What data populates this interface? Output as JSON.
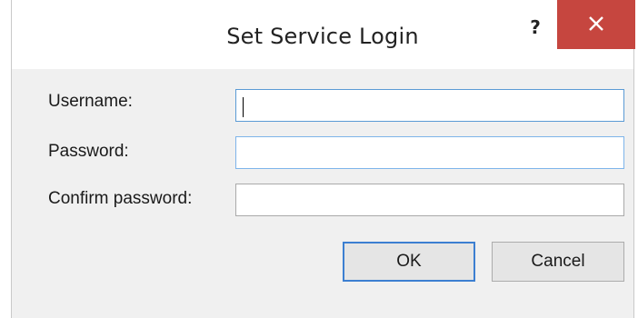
{
  "dialog": {
    "title": "Set Service Login",
    "help_glyph": "?",
    "close_icon": "close-icon"
  },
  "form": {
    "username": {
      "label": "Username:",
      "value": ""
    },
    "password": {
      "label": "Password:",
      "value": ""
    },
    "confirm_password": {
      "label": "Confirm password:",
      "value": ""
    }
  },
  "buttons": {
    "ok_label": "OK",
    "cancel_label": "Cancel"
  },
  "colors": {
    "close_button": "#c6463f",
    "focus_border": "#5b9bd5",
    "default_button_border": "#3c7fd1",
    "form_background": "#f0f0f0"
  }
}
